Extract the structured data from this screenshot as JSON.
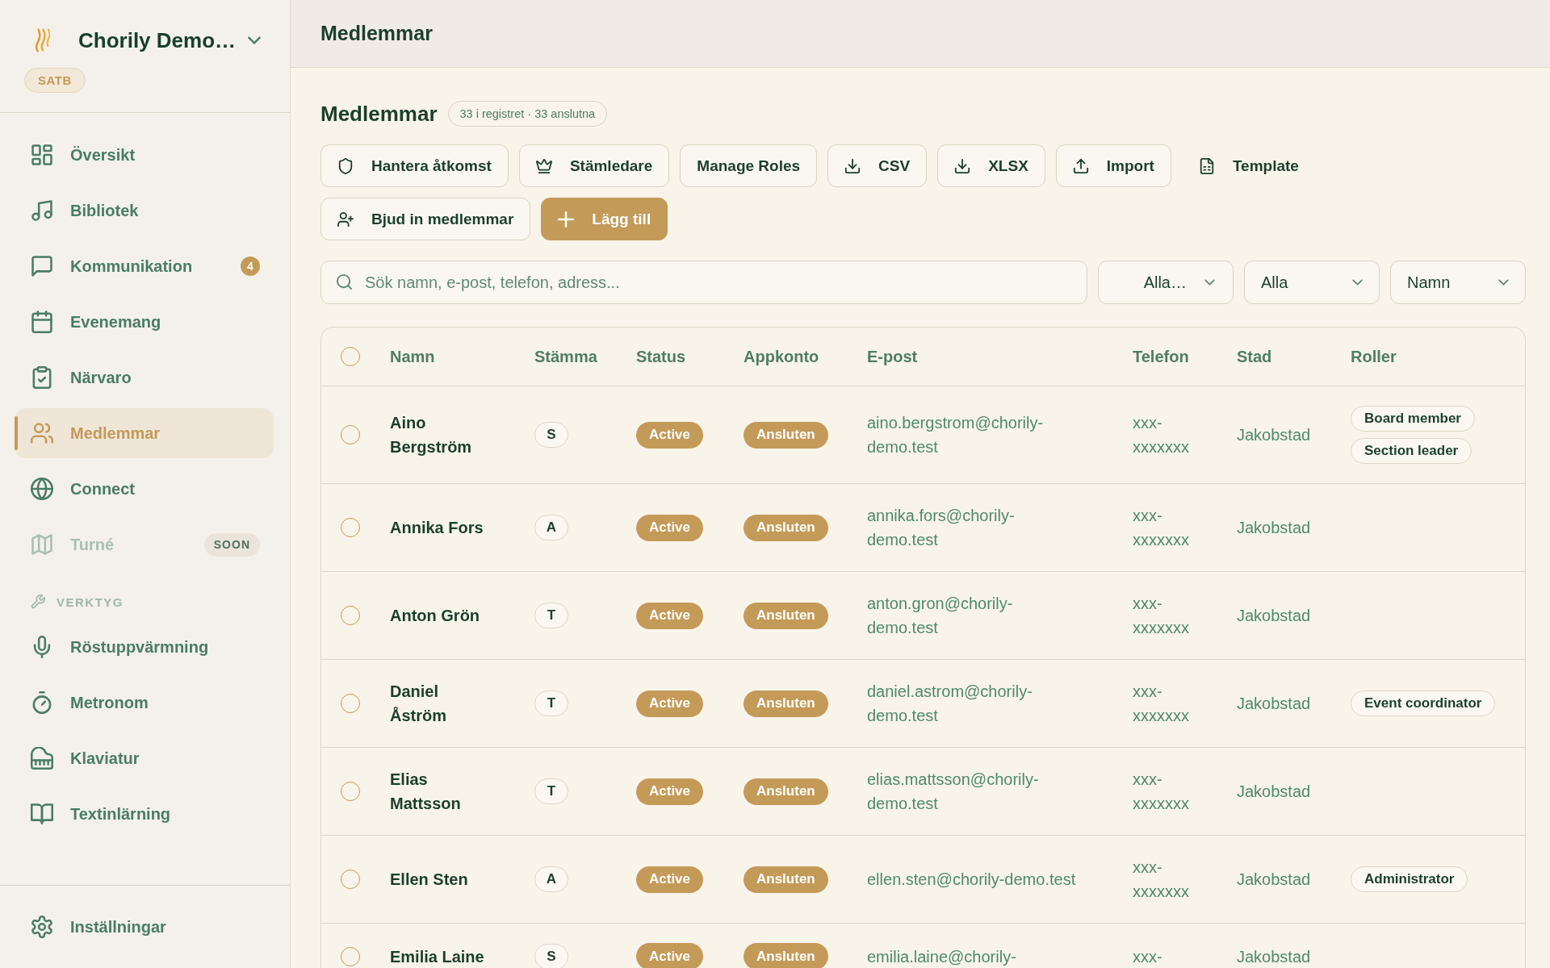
{
  "sidebar": {
    "brand": {
      "name": "Chorily Demo…",
      "tag": "SATB"
    },
    "nav": [
      {
        "label": "Översikt",
        "selected": false,
        "disabled": false
      },
      {
        "label": "Bibliotek",
        "selected": false,
        "disabled": false
      },
      {
        "label": "Kommunikation",
        "badge": "4",
        "selected": false,
        "disabled": false
      },
      {
        "label": "Evenemang",
        "selected": false,
        "disabled": false
      },
      {
        "label": "Närvaro",
        "selected": false,
        "disabled": false
      },
      {
        "label": "Medlemmar",
        "selected": true,
        "disabled": false
      },
      {
        "label": "Connect",
        "selected": false,
        "disabled": false
      },
      {
        "label": "Turné",
        "tag": "SOON",
        "selected": false,
        "disabled": true
      }
    ],
    "tools_heading": "VERKTYG",
    "tools": [
      {
        "label": "Röstuppvärmning",
        "selected": false
      },
      {
        "label": "Metronom",
        "selected": false
      },
      {
        "label": "Klaviatur",
        "selected": false
      },
      {
        "label": "Textinlärning",
        "selected": false
      }
    ],
    "footer": [
      {
        "label": "Inställningar",
        "selected": false
      }
    ]
  },
  "header": {
    "title": "Medlemmar"
  },
  "page": {
    "title": "Medlemmar",
    "summary": "33 i registret · 33 anslutna"
  },
  "toolbar_rows": [
    {
      "buttons": [
        {
          "label": "Hantera åtkomst",
          "kind": "outline"
        },
        {
          "label": "Stämledare",
          "kind": "outline"
        },
        {
          "label": "Manage Roles",
          "kind": "outline"
        },
        {
          "label": "CSV",
          "kind": "outline"
        },
        {
          "label": "XLSX",
          "kind": "outline"
        },
        {
          "label": "Import",
          "kind": "outline"
        },
        {
          "label": "Template",
          "kind": "plain"
        }
      ]
    },
    {
      "buttons": [
        {
          "label": "Bjud in medlemmar",
          "kind": "outline"
        },
        {
          "label": "Lägg till",
          "kind": "primary"
        }
      ]
    }
  ],
  "filters": {
    "search": {
      "placeholder": "Sök namn, e-post, telefon, adress..."
    },
    "selects": [
      {
        "value": "Alla…"
      },
      {
        "value": "Alla"
      },
      {
        "value": "Namn"
      }
    ]
  },
  "table": {
    "select_all": {
      "checked": false
    },
    "columns": [
      "Namn",
      "Stämma",
      "Status",
      "Appkonto",
      "E-post",
      "Telefon",
      "Stad",
      "Roller"
    ],
    "rows": [
      {
        "selected": false,
        "name": "Aino Bergström",
        "voice": "S",
        "status": "Active",
        "app_account": "Ansluten",
        "email": "aino.bergstrom@chorily-demo.test",
        "phone": "xxx-xxxxxxx",
        "city": "Jakobstad",
        "roles": [
          "Board member",
          "Section leader"
        ]
      },
      {
        "selected": false,
        "name": "Annika Fors",
        "voice": "A",
        "status": "Active",
        "app_account": "Ansluten",
        "email": "annika.fors@chorily-demo.test",
        "phone": "xxx-xxxxxxx",
        "city": "Jakobstad",
        "roles": []
      },
      {
        "selected": false,
        "name": "Anton Grön",
        "voice": "T",
        "status": "Active",
        "app_account": "Ansluten",
        "email": "anton.gron@chorily-demo.test",
        "phone": "xxx-xxxxxxx",
        "city": "Jakobstad",
        "roles": []
      },
      {
        "selected": false,
        "name": "Daniel Åström",
        "voice": "T",
        "status": "Active",
        "app_account": "Ansluten",
        "email": "daniel.astrom@chorily-demo.test",
        "phone": "xxx-xxxxxxx",
        "city": "Jakobstad",
        "roles": [
          "Event coordinator"
        ]
      },
      {
        "selected": false,
        "name": "Elias Mattsson",
        "voice": "T",
        "status": "Active",
        "app_account": "Ansluten",
        "email": "elias.mattsson@chorily-demo.test",
        "phone": "xxx-xxxxxxx",
        "city": "Jakobstad",
        "roles": []
      },
      {
        "selected": false,
        "name": "Ellen Sten",
        "voice": "A",
        "status": "Active",
        "app_account": "Ansluten",
        "email": "ellen.sten@chorily-demo.test",
        "phone": "xxx-xxxxxxx",
        "city": "Jakobstad",
        "roles": [
          "Administrator"
        ]
      },
      {
        "selected": false,
        "name": "Emilia Laine",
        "voice": "S",
        "status": "Active",
        "app_account": "Ansluten",
        "email": "emilia.laine@chorily-",
        "phone": "xxx-",
        "city": "Jakobstad",
        "roles": []
      }
    ]
  }
}
